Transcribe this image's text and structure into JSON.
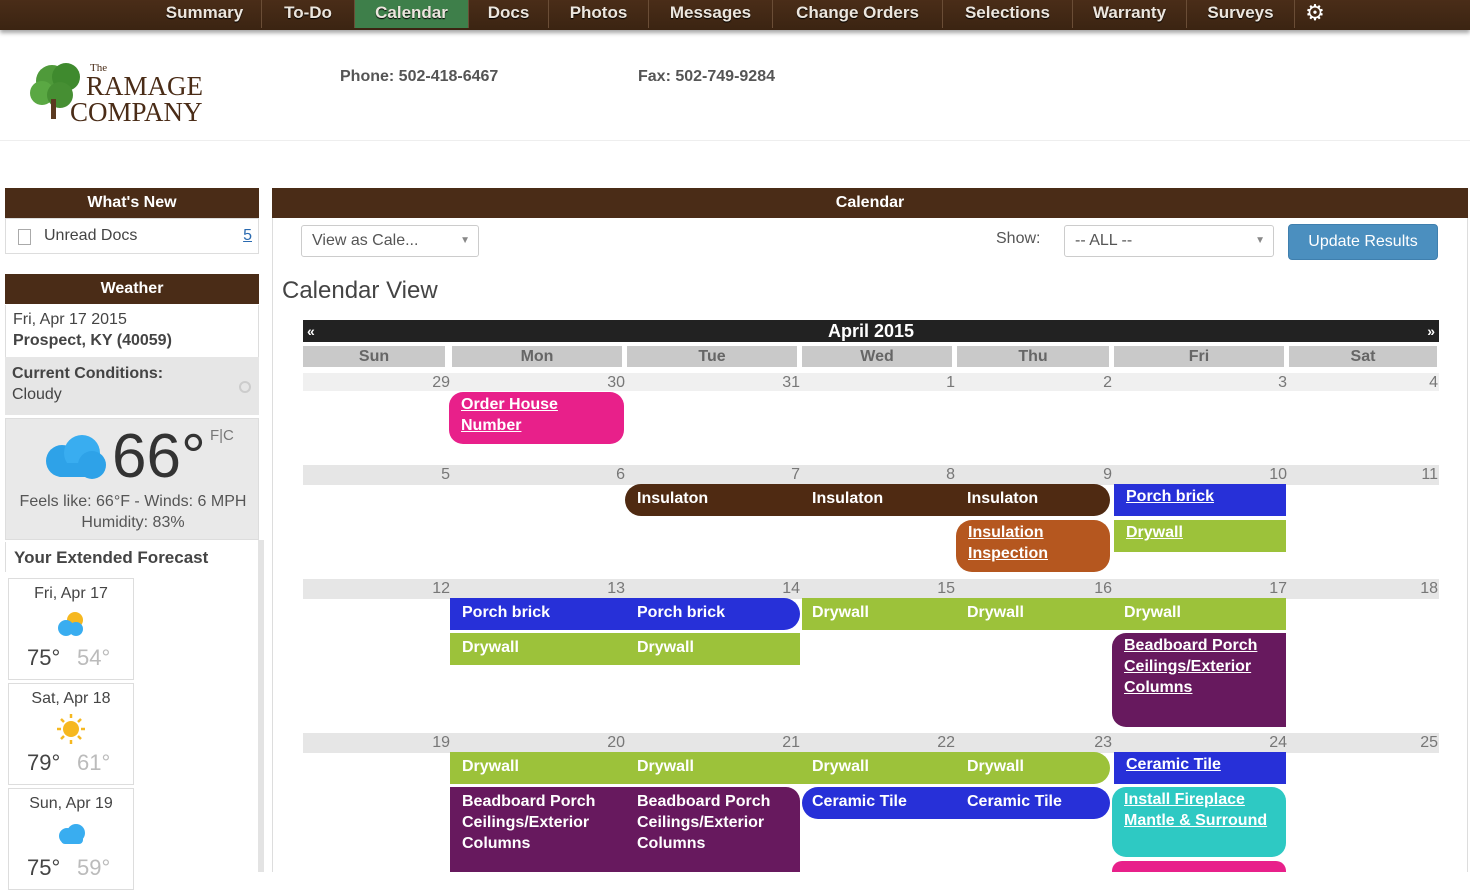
{
  "nav": {
    "items": [
      "Summary",
      "To-Do",
      "Calendar",
      "Docs",
      "Photos",
      "Messages",
      "Change Orders",
      "Selections",
      "Warranty",
      "Surveys"
    ],
    "active": "Calendar"
  },
  "header": {
    "logo_text": "The Ramage Company",
    "phone": "Phone: 502-418-6467",
    "fax": "Fax: 502-749-9284"
  },
  "whats_new": {
    "title": "What's New",
    "unread_label": "Unread Docs",
    "unread_count": "5"
  },
  "weather": {
    "title": "Weather",
    "date": "Fri, Apr 17 2015",
    "location": "Prospect, KY (40059)",
    "conditions_label": "Current Conditions:",
    "conditions": "Cloudy",
    "temp": "66°",
    "unit": "F|C",
    "feels": "Feels like: 66°F - Winds: 6 MPH Humidity: 83%",
    "forecast_title": "Your Extended Forecast",
    "forecast": [
      {
        "day": "Fri, Apr 17",
        "hi": "75°",
        "lo": "54°",
        "icon": "partly-cloudy"
      },
      {
        "day": "Sat, Apr 18",
        "hi": "79°",
        "lo": "61°",
        "icon": "sunny"
      },
      {
        "day": "Sun, Apr 19",
        "hi": "75°",
        "lo": "59°",
        "icon": "cloudy"
      }
    ]
  },
  "calendar_panel": {
    "title": "Calendar",
    "view_select": "View as Cale...",
    "show_label": "Show:",
    "show_select": "-- ALL --",
    "update_button": "Update Results",
    "view_title": "Calendar View",
    "month": "April 2015",
    "prev": "«",
    "next": "»",
    "days_of_week": [
      "Sun",
      "Mon",
      "Tue",
      "Wed",
      "Thu",
      "Fri",
      "Sat"
    ],
    "weeks": [
      [
        "29",
        "30",
        "31",
        "1",
        "2",
        "3",
        "4"
      ],
      [
        "5",
        "6",
        "7",
        "8",
        "9",
        "10",
        "11"
      ],
      [
        "12",
        "13",
        "14",
        "15",
        "16",
        "17",
        "18"
      ],
      [
        "19",
        "20",
        "21",
        "22",
        "23",
        "24",
        "25"
      ]
    ],
    "events": {
      "order_house": "Order House Number",
      "insulation": "Insulaton",
      "insulation_inspection": "Insulation Inspection",
      "porch_brick": "Porch brick",
      "drywall": "Drywall",
      "beadboard": "Beadboard Porch Ceilings/Exterior Columns",
      "ceramic_tile": "Ceramic Tile",
      "fireplace": "Install Fireplace Mantle & Surround"
    },
    "colors": {
      "pink": "#e8208a",
      "brown": "#4f2a12",
      "orange": "#b5571f",
      "blue": "#2730d8",
      "green": "#9cc23a",
      "purple": "#67195e",
      "teal": "#2ec9c3"
    }
  }
}
